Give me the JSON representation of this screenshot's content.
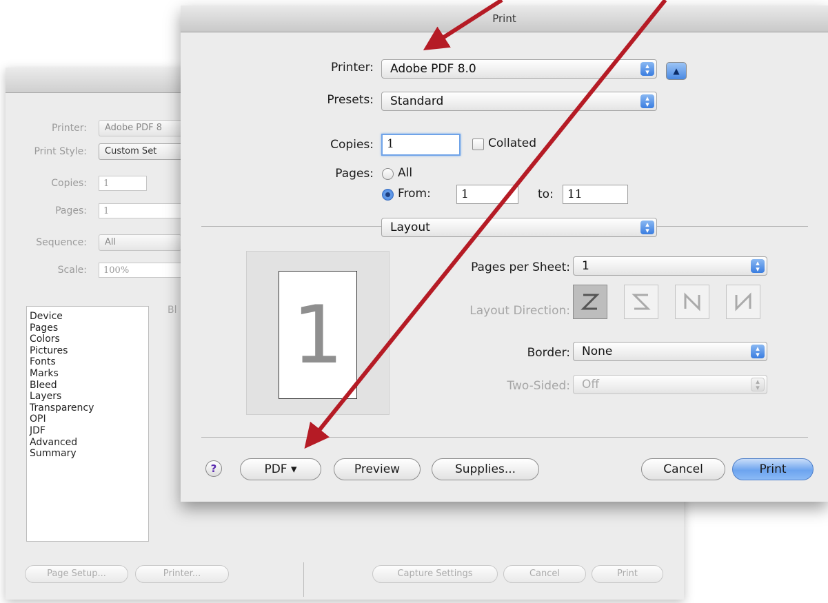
{
  "background_dialog": {
    "fields": [
      {
        "label": "Printer:",
        "value": "Adobe PDF 8"
      },
      {
        "label": "Print Style:",
        "value": "Custom Set"
      },
      {
        "label": "Copies:",
        "value": "1"
      },
      {
        "label": "Pages:",
        "value": "1"
      },
      {
        "label": "Sequence:",
        "value": "All"
      },
      {
        "label": "Scale:",
        "value": "100%"
      }
    ],
    "stray_text": "Bl",
    "categories": [
      "Device",
      "Pages",
      "Colors",
      "Pictures",
      "Fonts",
      "Marks",
      "Bleed",
      "Layers",
      "Transparency",
      "OPI",
      "JDF",
      "Advanced",
      "Summary"
    ],
    "buttons": {
      "page_setup": "Page Setup...",
      "printer": "Printer...",
      "capture_settings": "Capture Settings",
      "cancel": "Cancel",
      "print": "Print"
    }
  },
  "print_dialog": {
    "title": "Print",
    "printer_label": "Printer:",
    "printer_value": "Adobe PDF 8.0",
    "expand_glyph": "▲",
    "presets_label": "Presets:",
    "presets_value": "Standard",
    "copies_label": "Copies:",
    "copies_value": "1",
    "collated_label": "Collated",
    "pages_label": "Pages:",
    "all_label": "All",
    "from_label": "From:",
    "from_value": "1",
    "to_label": "to:",
    "to_value": "11",
    "section_value": "Layout",
    "preview_number": "1",
    "pages_per_sheet_label": "Pages per Sheet:",
    "pages_per_sheet_value": "1",
    "layout_direction_label": "Layout Direction:",
    "border_label": "Border:",
    "border_value": "None",
    "two_sided_label": "Two-Sided:",
    "two_sided_value": "Off",
    "help_glyph": "?",
    "pdf_button": "PDF ▾",
    "preview_button": "Preview",
    "supplies_button": "Supplies...",
    "cancel_button": "Cancel",
    "print_button": "Print"
  },
  "colors": {
    "annotation_arrow": "#b51b25",
    "default_button": "#6da4ef"
  }
}
